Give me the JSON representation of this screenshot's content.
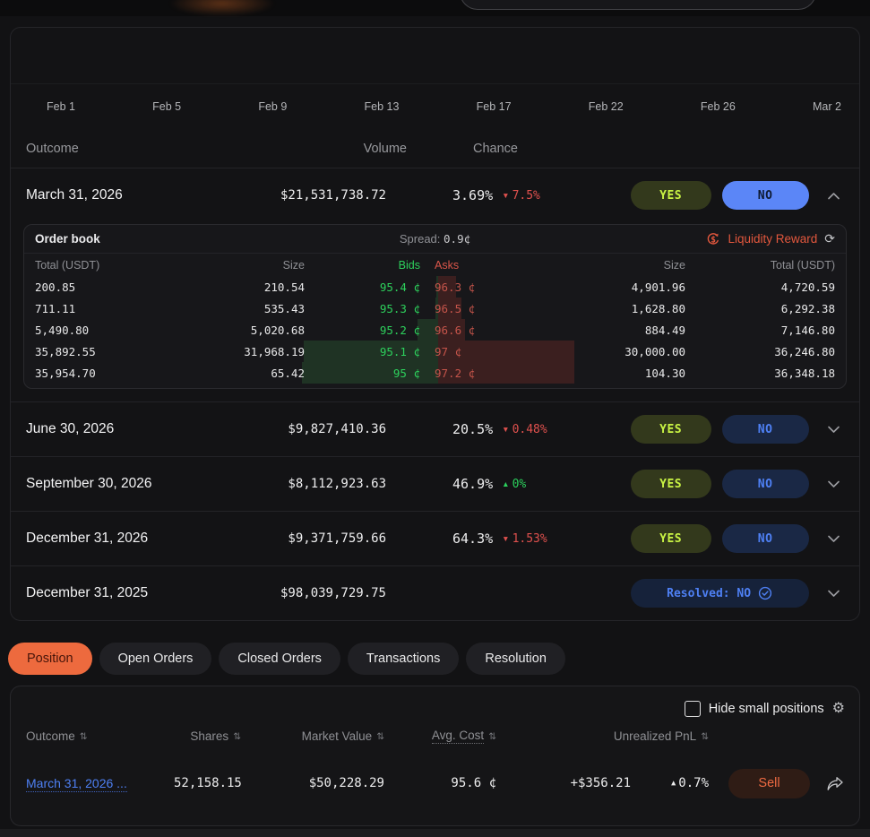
{
  "chart": {
    "x_ticks": [
      "Feb 1",
      "Feb 5",
      "Feb 9",
      "Feb 13",
      "Feb 17",
      "Feb 22",
      "Feb 26",
      "Mar 2"
    ]
  },
  "market": {
    "columns": [
      "Outcome",
      "Volume",
      "Chance"
    ],
    "yes_label": "YES",
    "no_label": "NO",
    "rows": [
      {
        "outcome": "March 31, 2026",
        "volume": "$21,531,738.72",
        "chance": "3.69%",
        "change": "7.5%",
        "direction": "down",
        "expanded": true
      },
      {
        "outcome": "June 30, 2026",
        "volume": "$9,827,410.36",
        "chance": "20.5%",
        "change": "0.48%",
        "direction": "down",
        "expanded": false
      },
      {
        "outcome": "September 30, 2026",
        "volume": "$8,112,923.63",
        "chance": "46.9%",
        "change": "0%",
        "direction": "up",
        "expanded": false
      },
      {
        "outcome": "December 31, 2026",
        "volume": "$9,371,759.66",
        "chance": "64.3%",
        "change": "1.53%",
        "direction": "down",
        "expanded": false
      },
      {
        "outcome": "December 31, 2025",
        "volume": "$98,039,729.75",
        "resolved_label": "Resolved: NO",
        "expanded": false
      }
    ]
  },
  "order_book": {
    "title": "Order book",
    "spread_label": "Spread:",
    "spread_value": "0.9¢",
    "liquidity_reward_label": "Liquidity Reward",
    "columns": [
      "Total (USDT)",
      "Size",
      "Bids",
      "Asks",
      "Size",
      "Total (USDT)"
    ],
    "rows": [
      {
        "bid_total": "200.85",
        "bid_size": "210.54",
        "bid": "95.4 ¢",
        "ask": "96.3 ¢",
        "ask_size": "4,901.96",
        "ask_total": "4,720.59",
        "bid_depth": 0.01,
        "ask_depth": 0.13
      },
      {
        "bid_total": "711.11",
        "bid_size": "535.43",
        "bid": "95.3 ¢",
        "ask": "96.5 ¢",
        "ask_size": "1,628.80",
        "ask_total": "6,292.38",
        "bid_depth": 0.02,
        "ask_depth": 0.17
      },
      {
        "bid_total": "5,490.80",
        "bid_size": "5,020.68",
        "bid": "95.2 ¢",
        "ask": "96.6 ¢",
        "ask_size": "884.49",
        "ask_total": "7,146.80",
        "bid_depth": 0.15,
        "ask_depth": 0.2
      },
      {
        "bid_total": "35,892.55",
        "bid_size": "31,968.19",
        "bid": "95.1 ¢",
        "ask": "97 ¢",
        "ask_size": "30,000.00",
        "ask_total": "36,246.80",
        "bid_depth": 0.99,
        "ask_depth": 1.0
      },
      {
        "bid_total": "35,954.70",
        "bid_size": "65.42",
        "bid": "95 ¢",
        "ask": "97.2 ¢",
        "ask_size": "104.30",
        "ask_total": "36,348.18",
        "bid_depth": 1.0,
        "ask_depth": 1.0
      }
    ]
  },
  "tabs": [
    {
      "label": "Position",
      "active": true
    },
    {
      "label": "Open Orders",
      "active": false
    },
    {
      "label": "Closed Orders",
      "active": false
    },
    {
      "label": "Transactions",
      "active": false
    },
    {
      "label": "Resolution",
      "active": false
    }
  ],
  "positions": {
    "hide_small_label": "Hide small positions",
    "columns": [
      {
        "label": "Outcome",
        "dotted": false
      },
      {
        "label": "Shares",
        "dotted": false
      },
      {
        "label": "Market Value",
        "dotted": false
      },
      {
        "label": "Avg. Cost",
        "dotted": true
      },
      {
        "label": "Unrealized PnL",
        "dotted": false
      }
    ],
    "rows": [
      {
        "outcome": "March 31, 2026 ...",
        "shares": "52,158.15",
        "market_value": "$50,228.29",
        "avg_cost": "95.6 ¢",
        "pnl": "+$356.21",
        "pnl_pct": "0.7%",
        "direction": "up",
        "sell_label": "Sell"
      }
    ]
  },
  "icons": {
    "gear": "⚙",
    "refresh": "⟳",
    "sort": "⇅",
    "triangle_down": "▼",
    "triangle_up": "▲"
  },
  "colors": {
    "accent_orange": "#ed6a3e",
    "liquidity_red": "#e2573d",
    "bid_green": "#2dd15c",
    "ask_red": "#c4544a",
    "change_red": "#e0514e",
    "change_green": "#2bd15c",
    "link_blue": "#4e80f4",
    "yes_text": "#c9f444",
    "no_active_bg": "#5b86f7",
    "sell_text": "#ee6a42"
  }
}
